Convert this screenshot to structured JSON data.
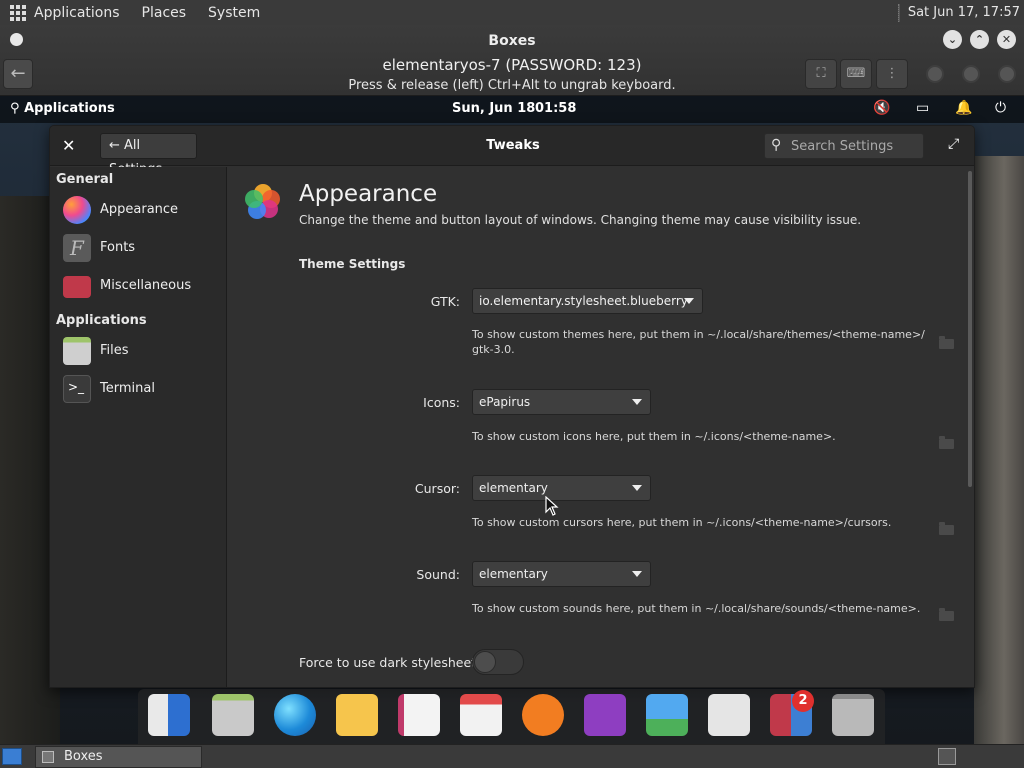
{
  "host_panel": {
    "menus": [
      "Applications",
      "Places",
      "System"
    ],
    "clock": "Sat Jun 17, 17:57"
  },
  "boxes": {
    "app_name": "Boxes",
    "vm_title": "elementaryos-7 (PASSWORD: 123)",
    "vm_subtitle": "Press & release (left) Ctrl+Alt to ungrab keyboard."
  },
  "guest_panel": {
    "applications": "Applications",
    "date": "Sun, Jun 18",
    "time": "01:58"
  },
  "settings": {
    "back_label": "All Settings",
    "title": "Tweaks",
    "search_placeholder": "Search Settings",
    "sidebar": {
      "general_heading": "General",
      "general_items": [
        {
          "label": "Appearance",
          "icon": "appearance-icon"
        },
        {
          "label": "Fonts",
          "icon": "fonts-icon"
        },
        {
          "label": "Miscellaneous",
          "icon": "miscellaneous-icon"
        }
      ],
      "apps_heading": "Applications",
      "app_items": [
        {
          "label": "Files",
          "icon": "files-icon"
        },
        {
          "label": "Terminal",
          "icon": "terminal-icon"
        }
      ]
    },
    "page": {
      "title": "Appearance",
      "description": "Change the theme and button layout of windows. Changing theme may cause visibility issue.",
      "section": "Theme Settings",
      "rows": [
        {
          "label": "GTK:",
          "value": "io.elementary.stylesheet.blueberry",
          "hint_line1": "To show custom themes here, put them in ~/.local/share/themes/<theme-name>/",
          "hint_line2": "gtk-3.0."
        },
        {
          "label": "Icons:",
          "value": "ePapirus",
          "hint_line1": "To show custom icons here, put them in ~/.icons/<theme-name>."
        },
        {
          "label": "Cursor:",
          "value": "elementary",
          "hint_line1": "To show custom cursors here, put them in ~/.icons/<theme-name>/cursors."
        },
        {
          "label": "Sound:",
          "value": "elementary",
          "hint_line1": "To show custom sounds here, put them in ~/.local/share/sounds/<theme-name>."
        }
      ],
      "dark_toggle_label": "Force to use dark stylesheet:",
      "dark_toggle_on": false
    }
  },
  "dock": {
    "items": [
      "multitasking-view",
      "files",
      "web-browser",
      "mail",
      "tasks",
      "calendar",
      "music",
      "videos",
      "photos",
      "system-settings",
      "appcenter",
      "trash"
    ],
    "appcenter_badge": "2"
  },
  "taskbar": {
    "task_label": "Boxes"
  },
  "colors": {
    "accent": "#3a7ed3",
    "badge": "#e0302e"
  }
}
